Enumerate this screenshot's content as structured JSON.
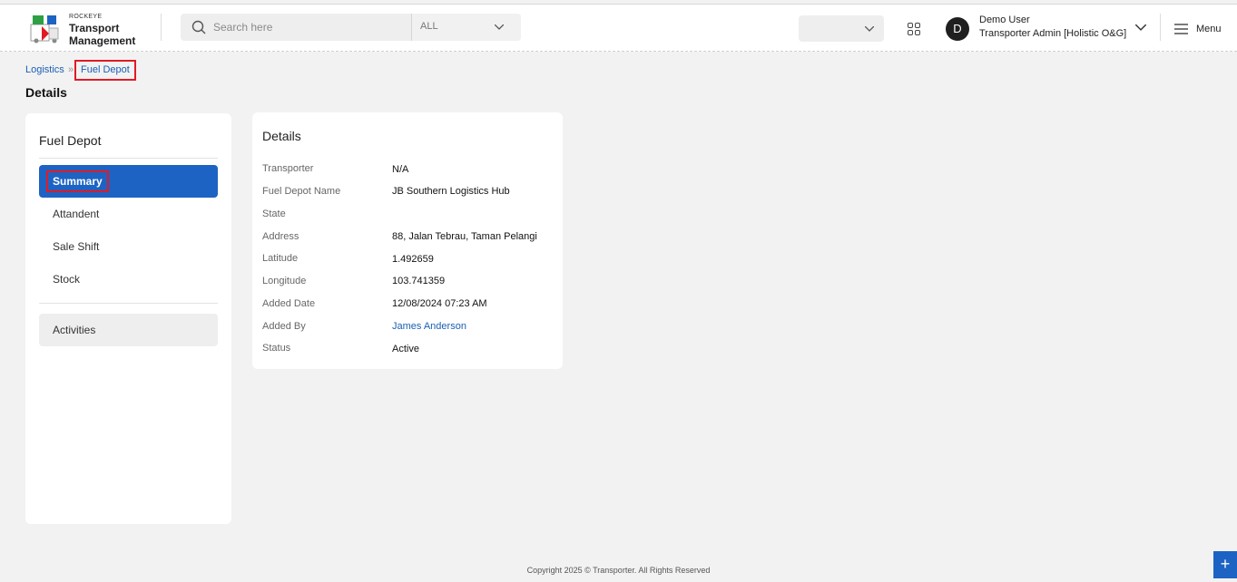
{
  "header": {
    "logo_small": "ROCKEYE",
    "logo_line1": "Transport",
    "logo_line2": "Management",
    "search_placeholder": "Search here",
    "search_scope": "ALL",
    "org_select_value": "",
    "user_name": "Demo User",
    "user_role": "Transporter Admin [Holistic O&G]",
    "avatar_initial": "D",
    "menu_label": "Menu"
  },
  "breadcrumb": {
    "parent": "Logistics",
    "separator": "»",
    "current": "Fuel Depot"
  },
  "page_title": "Details",
  "sidebar": {
    "title": "Fuel Depot",
    "items": [
      {
        "label": "Summary",
        "active": true
      },
      {
        "label": "Attandent"
      },
      {
        "label": "Sale Shift"
      },
      {
        "label": "Stock"
      }
    ],
    "activities_label": "Activities"
  },
  "details": {
    "title": "Details",
    "rows": [
      {
        "label": "Transporter",
        "value": "N/A"
      },
      {
        "label": "Fuel Depot Name",
        "value": "JB Southern Logistics Hub"
      },
      {
        "label": "State",
        "value": ""
      },
      {
        "label": "Address",
        "value": "88, Jalan Tebrau, Taman Pelangi"
      },
      {
        "label": "Latitude",
        "value": "1.492659"
      },
      {
        "label": "Longitude",
        "value": "103.741359"
      },
      {
        "label": "Added Date",
        "value": "12/08/2024 07:23 AM"
      },
      {
        "label": "Added By",
        "value": "James Anderson"
      },
      {
        "label": "Status",
        "value": "Active"
      }
    ]
  },
  "footer": "Copyright 2025 © Transporter. All Rights Reserved",
  "fab_label": "+",
  "colors": {
    "accent": "#1d63c3",
    "link": "#1a5fb4",
    "highlight_border": "#e01b24",
    "background": "#f2f2f2"
  }
}
